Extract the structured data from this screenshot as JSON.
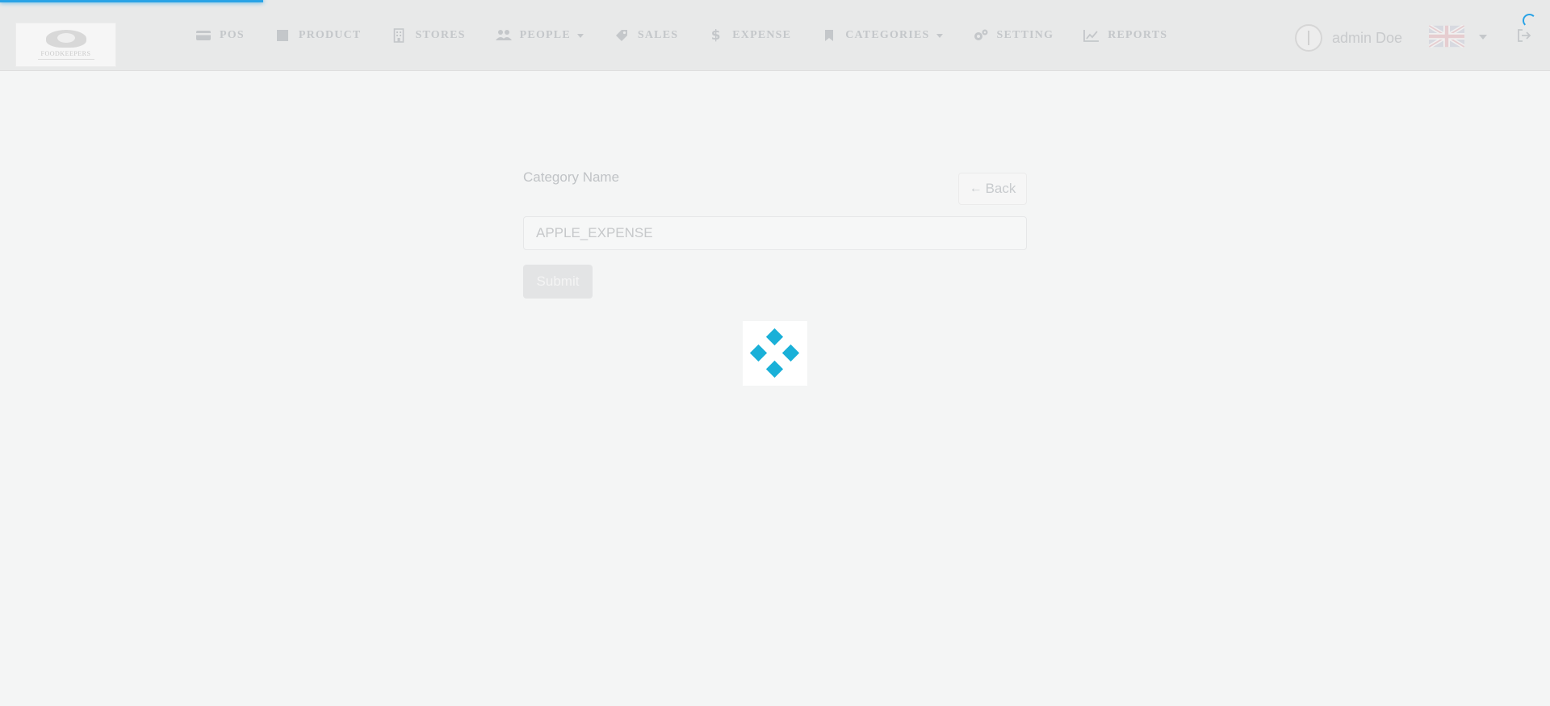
{
  "brand": {
    "logo_text": "FOODKEEPERS",
    "accent_color": "#1ab0d8",
    "progress_color": "#29a3e6"
  },
  "loading": {
    "progress_fraction": 0.17
  },
  "nav": {
    "items": [
      {
        "label": "POS",
        "icon": "credit-card-icon",
        "dropdown": false
      },
      {
        "label": "PRODUCT",
        "icon": "square-icon",
        "dropdown": false
      },
      {
        "label": "STORES",
        "icon": "building-icon",
        "dropdown": false
      },
      {
        "label": "PEOPLE",
        "icon": "users-icon",
        "dropdown": true
      },
      {
        "label": "SALES",
        "icon": "tag-icon",
        "dropdown": false
      },
      {
        "label": "EXPENSE",
        "icon": "dollar-icon",
        "dropdown": false
      },
      {
        "label": "CATEGORIES",
        "icon": "bookmark-icon",
        "dropdown": true
      },
      {
        "label": "SETTING",
        "icon": "gears-icon",
        "dropdown": false
      },
      {
        "label": "REPORTS",
        "icon": "line-chart-icon",
        "dropdown": false
      }
    ]
  },
  "user": {
    "name": "admin Doe",
    "language_icon": "uk-flag-icon"
  },
  "form": {
    "label": "Category Name",
    "back_label": "Back",
    "input_value": "APPLE_EXPENSE",
    "submit_label": "Submit"
  }
}
